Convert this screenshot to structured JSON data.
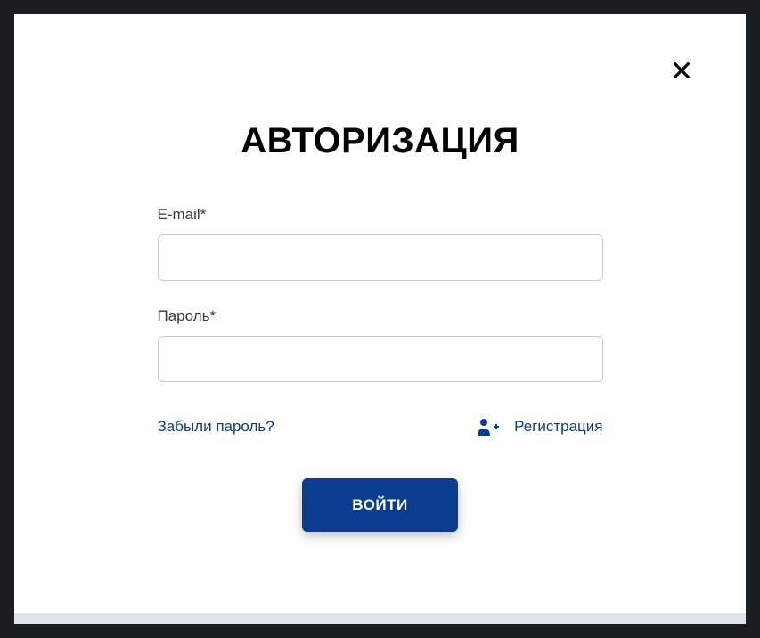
{
  "modal": {
    "title": "АВТОРИЗАЦИЯ",
    "email_label": "E-mail",
    "email_required": "*",
    "email_value": "",
    "password_label": "Пароль",
    "password_required": "*",
    "password_value": "",
    "forgot_password": "Забыли пароль?",
    "register": "Регистрация",
    "submit": "ВОЙТИ"
  }
}
